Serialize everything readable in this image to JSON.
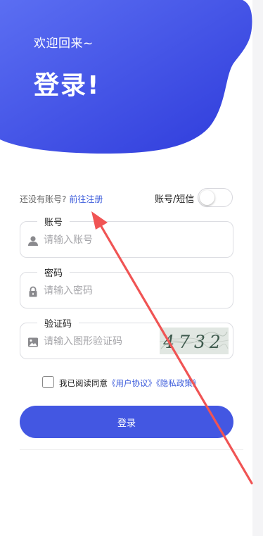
{
  "header": {
    "welcome": "欢迎回来~",
    "title": "登录!"
  },
  "register": {
    "prompt": "还没有账号?",
    "link": "前往注册"
  },
  "login_mode": {
    "label": "账号/短信",
    "toggle_on": false
  },
  "fields": {
    "account": {
      "label": "账号",
      "placeholder": "请输入账号",
      "icon": "user-icon"
    },
    "password": {
      "label": "密码",
      "placeholder": "请输入密码",
      "icon": "lock-icon"
    },
    "captcha": {
      "label": "验证码",
      "placeholder": "请输入图形验证码",
      "icon": "image-icon",
      "code": "4732"
    }
  },
  "agreement": {
    "prefix": "我已阅读同意",
    "user_agreement": "《用户协议》",
    "privacy_policy": "《隐私政策》",
    "checked": false
  },
  "login_button": "登录",
  "colors": {
    "primary": "#4357e2",
    "header_gradient_start": "#5a6cf0",
    "header_gradient_end": "#3342dc",
    "link": "#3b5bdb",
    "annotation_arrow": "#f05454"
  }
}
